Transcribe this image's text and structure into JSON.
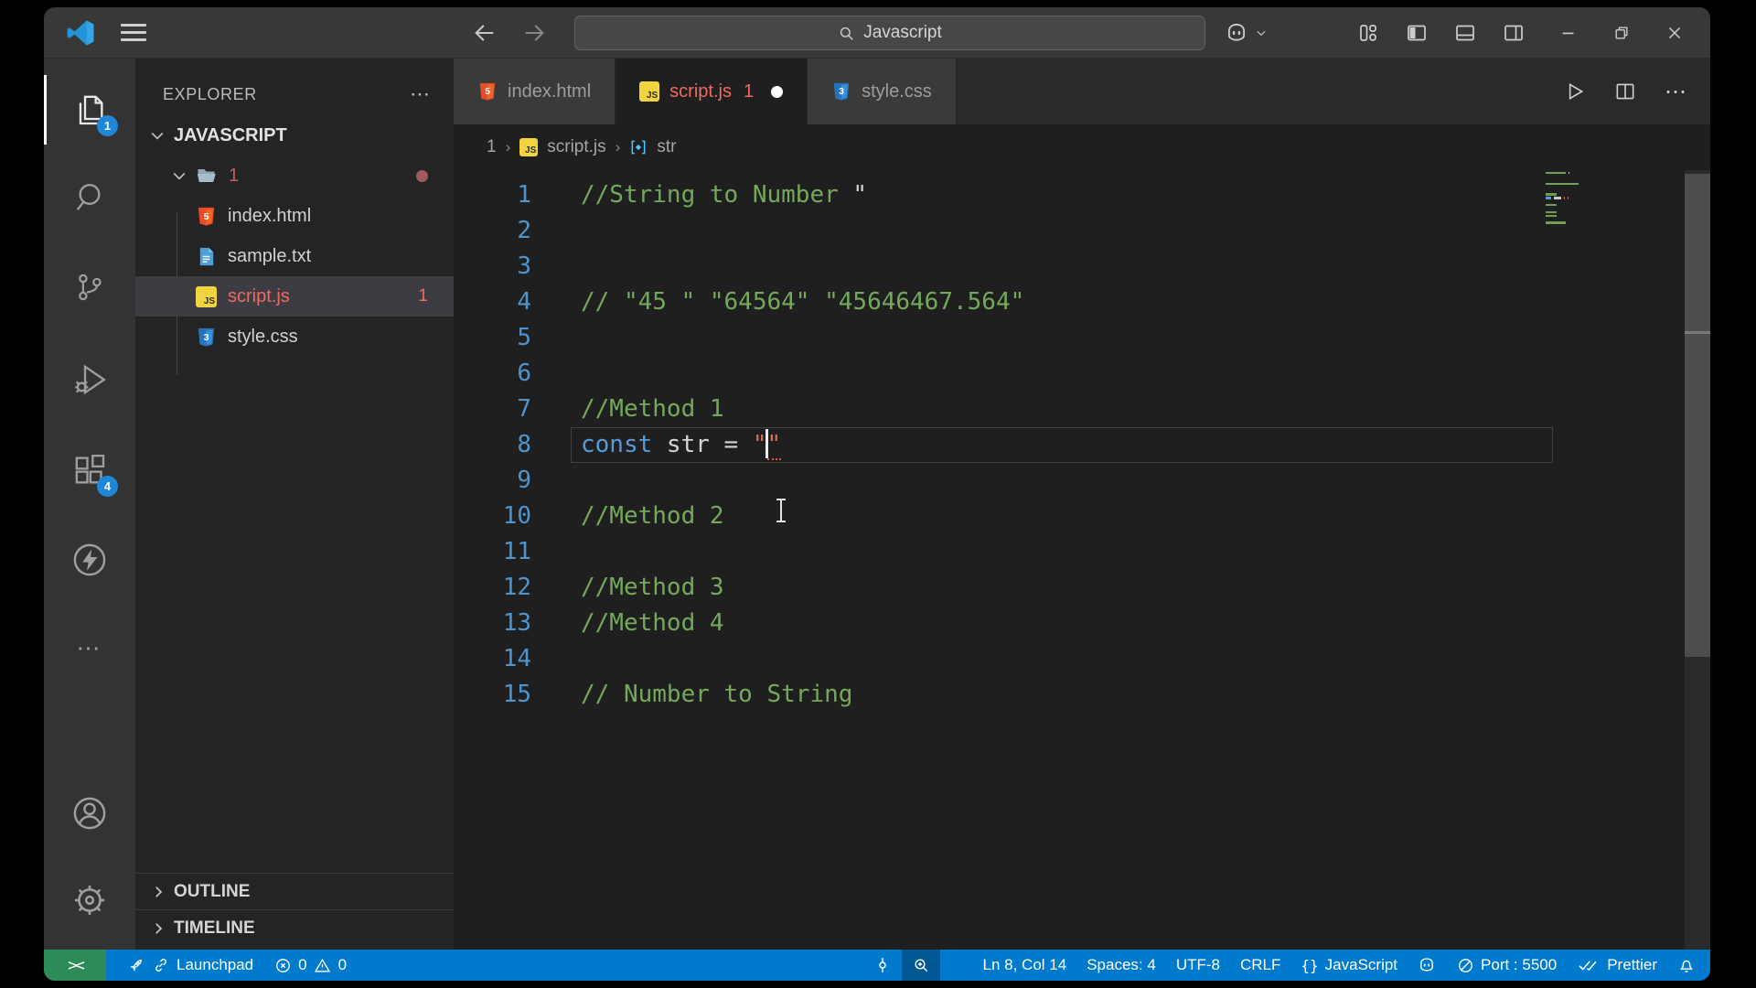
{
  "title_bar": {
    "search_value": "Javascript"
  },
  "activity_bar": {
    "explorer_badge": "1",
    "extensions_badge": "4",
    "more_label": "⋯"
  },
  "sidebar": {
    "header": "EXPLORER",
    "header_actions": "⋯",
    "section": "JAVASCRIPT",
    "folder": {
      "name": "1"
    },
    "files": [
      {
        "name": "index.html",
        "type": "html"
      },
      {
        "name": "sample.txt",
        "type": "text"
      },
      {
        "name": "script.js",
        "type": "js",
        "badge": "1",
        "selected": true
      },
      {
        "name": "style.css",
        "type": "css"
      }
    ],
    "panels": {
      "outline": "OUTLINE",
      "timeline": "TIMELINE"
    }
  },
  "editor": {
    "tabs": [
      {
        "name": "index.html"
      },
      {
        "name": "script.js",
        "badge": "1",
        "dirty": true,
        "active": true
      },
      {
        "name": "style.css"
      }
    ],
    "breadcrumb": {
      "folder": "1",
      "file": "script.js",
      "symbol": "str"
    },
    "lines": [
      {
        "n": "1",
        "tokens": [
          {
            "c": "cm",
            "t": "//String to Number "
          },
          {
            "c": "fg",
            "t": "\""
          }
        ]
      },
      {
        "n": "2",
        "tokens": []
      },
      {
        "n": "3",
        "tokens": []
      },
      {
        "n": "4",
        "tokens": [
          {
            "c": "cm",
            "t": "// \"45 \" \"64564\" \"45646467.564\""
          }
        ]
      },
      {
        "n": "5",
        "tokens": []
      },
      {
        "n": "6",
        "tokens": []
      },
      {
        "n": "7",
        "tokens": [
          {
            "c": "cm",
            "t": "//Method 1"
          }
        ]
      },
      {
        "n": "8",
        "current": true,
        "tokens": [
          {
            "c": "kw",
            "t": "const"
          },
          {
            "c": "fg",
            "t": " str = "
          },
          {
            "c": "str",
            "t": "\""
          },
          {
            "caret": true
          },
          {
            "c": "str err",
            "t": "\""
          }
        ]
      },
      {
        "n": "9",
        "tokens": []
      },
      {
        "n": "10",
        "tokens": [
          {
            "c": "cm",
            "t": "//Method 2"
          }
        ]
      },
      {
        "n": "11",
        "tokens": []
      },
      {
        "n": "12",
        "tokens": [
          {
            "c": "cm",
            "t": "//Method 3"
          }
        ]
      },
      {
        "n": "13",
        "tokens": [
          {
            "c": "cm",
            "t": "//Method 4"
          }
        ]
      },
      {
        "n": "14",
        "tokens": []
      },
      {
        "n": "15",
        "tokens": [
          {
            "c": "cm",
            "t": "// Number to String"
          }
        ]
      }
    ]
  },
  "status_bar": {
    "remote": "><",
    "launchpad": "Launchpad",
    "errors": "0",
    "warnings": "0",
    "cursor_position": "Ln 8, Col 14",
    "indentation": "Spaces: 4",
    "encoding": "UTF-8",
    "eol": "CRLF",
    "language": "JavaScript",
    "braces": "{}",
    "port": "Port : 5500",
    "formatter": "Prettier"
  },
  "colors": {
    "accent": "#007acc",
    "remote_green": "#2e8b57",
    "error_red": "#ef6a62",
    "badge_blue": "#1f87d7",
    "comment_green": "#74a95c",
    "keyword_blue": "#569cd6",
    "string_orange": "#d4705a",
    "line_number_blue": "#4e94ce"
  }
}
